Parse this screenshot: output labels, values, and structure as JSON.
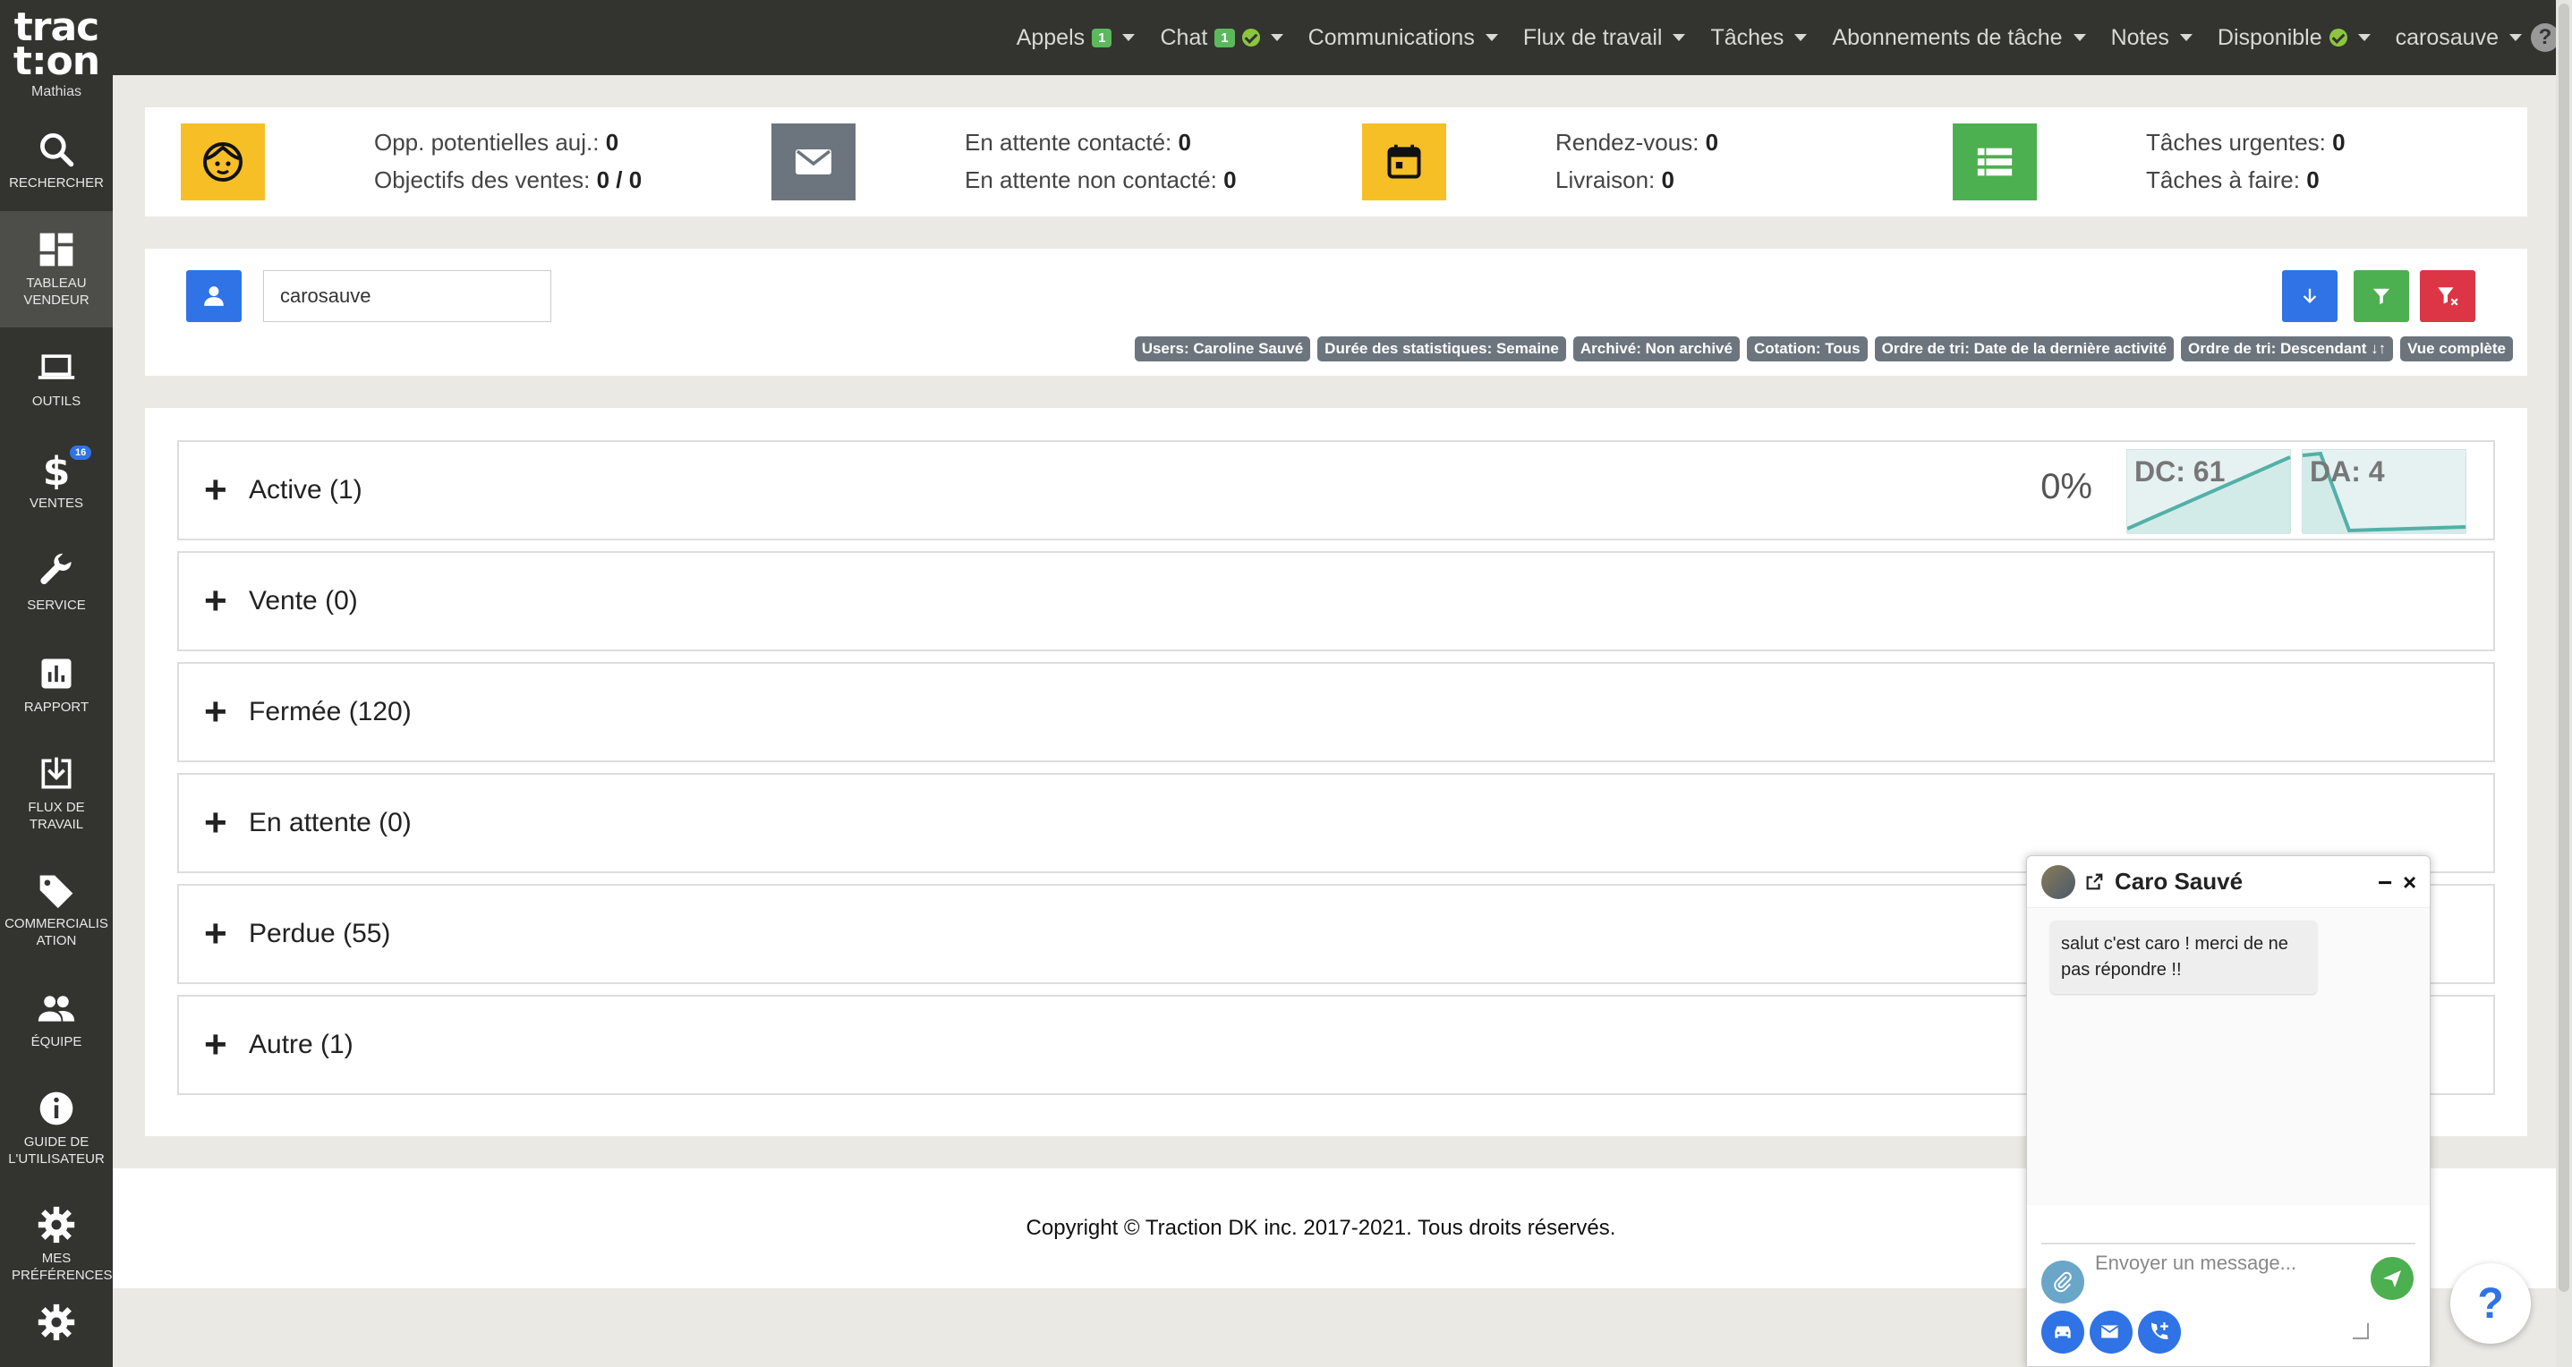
{
  "logo": {
    "line1": "trac",
    "line2": "t:on",
    "user": "Mathias"
  },
  "sidebar": {
    "items": [
      {
        "label": "RECHERCHER"
      },
      {
        "label": "TABLEAU VENDEUR"
      },
      {
        "label": "OUTILS"
      },
      {
        "label": "VENTES",
        "badge": "16"
      },
      {
        "label": "SERVICE"
      },
      {
        "label": "RAPPORT"
      },
      {
        "label": "FLUX DE TRAVAIL"
      },
      {
        "label": "COMMERCIALISATION"
      },
      {
        "label": "ÉQUIPE"
      },
      {
        "label": "GUIDE DE L'UTILISATEUR"
      },
      {
        "label": "MES PRÉFÉRENCES"
      }
    ]
  },
  "topnav": {
    "appels": "Appels",
    "appels_badge": "1",
    "chat": "Chat",
    "chat_badge": "1",
    "communications": "Communications",
    "flux": "Flux de travail",
    "taches": "Tâches",
    "abonnements": "Abonnements de tâche",
    "notes": "Notes",
    "disponible": "Disponible",
    "user": "carosauve",
    "help": "?"
  },
  "stats": {
    "opp_label": "Opp. potentielles auj.:",
    "opp_value": "0",
    "obj_label": "Objectifs des ventes:",
    "obj_value": "0 / 0",
    "att_c_label": "En attente contacté:",
    "att_c_value": "0",
    "att_nc_label": "En attente non contacté:",
    "att_nc_value": "0",
    "rdv_label": "Rendez-vous:",
    "rdv_value": "0",
    "liv_label": "Livraison:",
    "liv_value": "0",
    "urg_label": "Tâches urgentes:",
    "urg_value": "0",
    "faire_label": "Tâches à faire:",
    "faire_value": "0"
  },
  "filters": {
    "user_value": "carosauve",
    "tags": [
      "Users: Caroline Sauvé",
      "Durée des statistiques: Semaine",
      "Archivé: Non archivé",
      "Cotation: Tous",
      "Ordre de tri: Date de la dernière activité",
      "Ordre de tri: Descendant ↓↑",
      "Vue complète"
    ]
  },
  "sections": [
    {
      "label": "Active (1)"
    },
    {
      "label": "Vente (0)"
    },
    {
      "label": "Fermée (120)"
    },
    {
      "label": "En attente (0)"
    },
    {
      "label": "Perdue (55)"
    },
    {
      "label": "Autre (1)"
    }
  ],
  "active_stats": {
    "percent": "0%",
    "dc": "DC: 61",
    "da": "DA: 4"
  },
  "footer": {
    "text": "Copyright © Traction DK inc. 2017-2021. Tous droits réservés."
  },
  "chat": {
    "title": "Caro Sauvé",
    "message": "salut c'est caro ! merci de ne pas répondre !!",
    "placeholder": "Envoyer un message..."
  },
  "colors": {
    "yellow": "#f6bf26",
    "grey": "#6c757d",
    "green": "#4caf50",
    "blue": "#2f73e6",
    "red": "#dc3545"
  }
}
